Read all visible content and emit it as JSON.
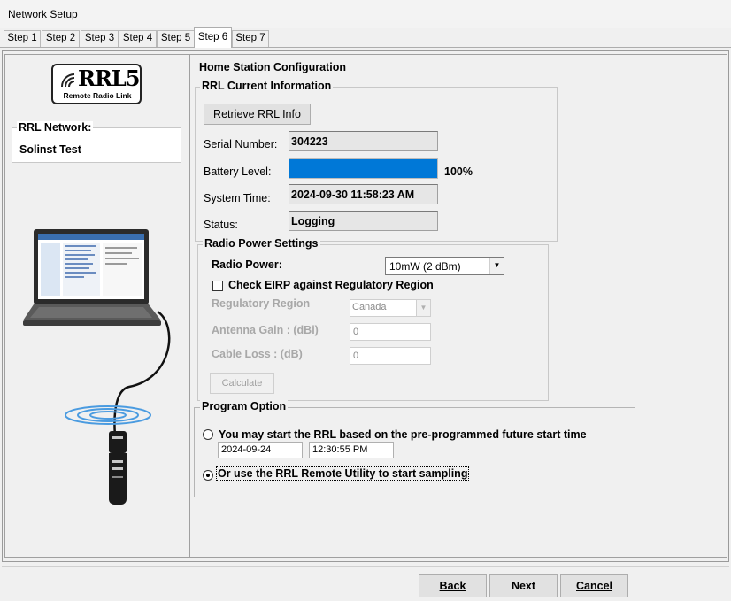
{
  "window": {
    "title": "Network Setup"
  },
  "tabs": [
    {
      "label": "Step 1"
    },
    {
      "label": "Step 2"
    },
    {
      "label": "Step 3"
    },
    {
      "label": "Step 4"
    },
    {
      "label": "Step 5"
    },
    {
      "label": "Step 6"
    },
    {
      "label": "Step 7"
    }
  ],
  "active_tab": "Step 6",
  "logo": {
    "text": "RRL5",
    "subtitle": "Remote Radio Link"
  },
  "rrl_network": {
    "legend": "RRL Network:",
    "name": "Solinst Test"
  },
  "home_station": {
    "title": "Home Station Configuration",
    "current_info": {
      "legend": "RRL Current Information",
      "retrieve_button": "Retrieve RRL Info",
      "serial_label": "Serial Number:",
      "serial_value": "304223",
      "battery_label": "Battery Level:",
      "battery_percent": 100,
      "battery_text": "100%",
      "time_label": "System Time:",
      "time_value": "2024-09-30 11:58:23 AM",
      "status_label": "Status:",
      "status_value": "Logging"
    },
    "radio_power": {
      "legend": "Radio Power Settings",
      "power_label": "Radio Power:",
      "power_value": "10mW (2 dBm)",
      "eirp_label": "Check EIRP against Regulatory Region",
      "eirp_checked": false,
      "region_label": "Regulatory Region",
      "region_value": "Canada",
      "gain_label": "Antenna Gain : (dBi)",
      "gain_value": "0",
      "loss_label": "Cable Loss : (dB)",
      "loss_value": "0",
      "calculate_button": "Calculate"
    },
    "program_option": {
      "legend": "Program Option",
      "option1_label": "You may start the RRL based on the pre-programmed future start time",
      "date_value": "2024-09-24",
      "time_value": "12:30:55 PM",
      "option2_label": "Or use the RRL Remote Utility to start sampling",
      "selected": "option2"
    }
  },
  "footer": {
    "back": "Back",
    "next": "Next",
    "cancel": "Cancel"
  },
  "colors": {
    "battery_fill": "#0078d7",
    "accent": "#0078d7"
  }
}
